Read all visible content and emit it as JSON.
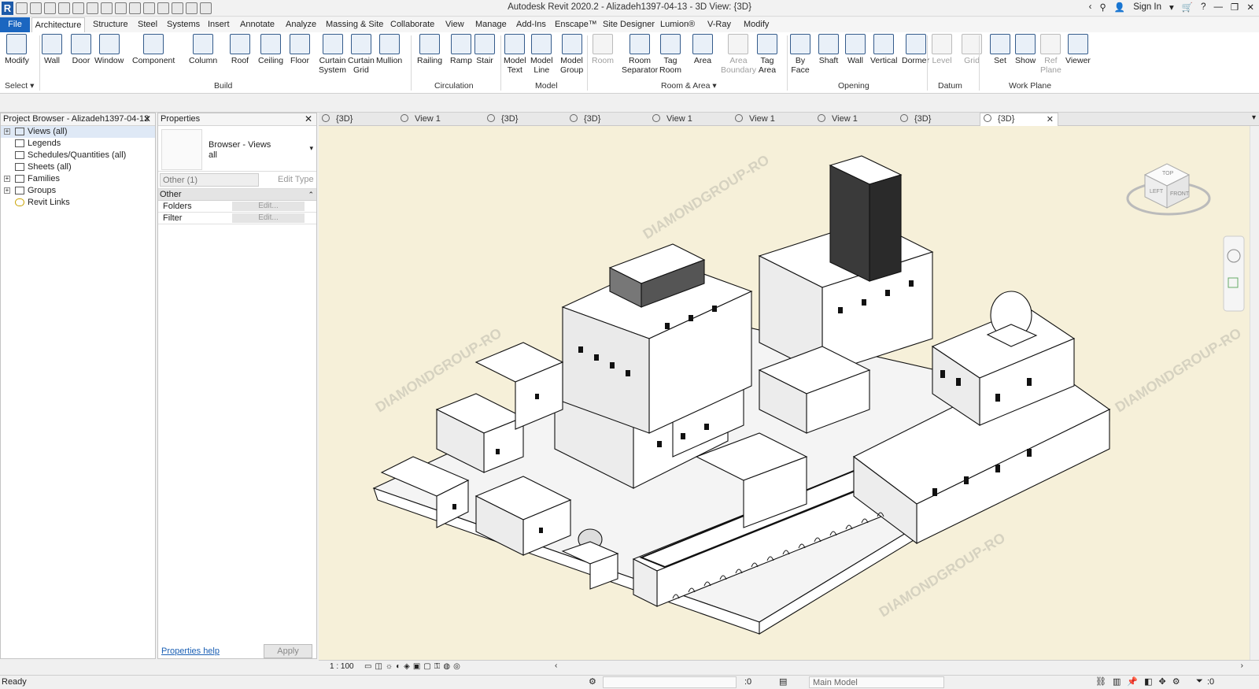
{
  "title_bar": {
    "title": "Autodesk Revit 2020.2 - Alizadeh1397-04-13 - 3D View: {3D}",
    "sign_in": "Sign In",
    "logo": "R"
  },
  "ribbon_tabs": [
    "File",
    "Architecture",
    "Structure",
    "Steel",
    "Systems",
    "Insert",
    "Annotate",
    "Analyze",
    "Massing & Site",
    "Collaborate",
    "View",
    "Manage",
    "Add-Ins",
    "Enscape™",
    "Site Designer",
    "Lumion®",
    "V-Ray",
    "Modify"
  ],
  "ribbon": {
    "tools": [
      {
        "l1": "Modify",
        "l2": ""
      },
      {
        "l1": "Wall",
        "l2": ""
      },
      {
        "l1": "Door",
        "l2": ""
      },
      {
        "l1": "Window",
        "l2": ""
      },
      {
        "l1": "Component",
        "l2": ""
      },
      {
        "l1": "Column",
        "l2": ""
      },
      {
        "l1": "Roof",
        "l2": ""
      },
      {
        "l1": "Ceiling",
        "l2": ""
      },
      {
        "l1": "Floor",
        "l2": ""
      },
      {
        "l1": "Curtain",
        "l2": "System"
      },
      {
        "l1": "Curtain",
        "l2": "Grid"
      },
      {
        "l1": "Mullion",
        "l2": ""
      },
      {
        "l1": "Railing",
        "l2": ""
      },
      {
        "l1": "Ramp",
        "l2": ""
      },
      {
        "l1": "Stair",
        "l2": ""
      },
      {
        "l1": "Model",
        "l2": "Text"
      },
      {
        "l1": "Model",
        "l2": "Line"
      },
      {
        "l1": "Model",
        "l2": "Group"
      },
      {
        "l1": "Room",
        "l2": ""
      },
      {
        "l1": "Room",
        "l2": "Separator"
      },
      {
        "l1": "Tag",
        "l2": "Room"
      },
      {
        "l1": "Area",
        "l2": ""
      },
      {
        "l1": "Area",
        "l2": "Boundary"
      },
      {
        "l1": "Tag",
        "l2": "Area"
      },
      {
        "l1": "By",
        "l2": "Face"
      },
      {
        "l1": "Shaft",
        "l2": ""
      },
      {
        "l1": "Wall",
        "l2": ""
      },
      {
        "l1": "Vertical",
        "l2": ""
      },
      {
        "l1": "Dormer",
        "l2": ""
      },
      {
        "l1": "Level",
        "l2": ""
      },
      {
        "l1": "Grid",
        "l2": ""
      },
      {
        "l1": "Set",
        "l2": ""
      },
      {
        "l1": "Show",
        "l2": ""
      },
      {
        "l1": "Ref",
        "l2": "Plane"
      },
      {
        "l1": "Viewer",
        "l2": ""
      }
    ],
    "groups": [
      "Select ▾",
      "Build",
      "Circulation",
      "Model",
      "Room & Area ▾",
      "Opening",
      "Datum",
      "Work Plane"
    ]
  },
  "project_browser": {
    "title": "Project Browser - Alizadeh1397-04-13",
    "items": [
      "Views (all)",
      "Legends",
      "Schedules/Quantities (all)",
      "Sheets (all)",
      "Families",
      "Groups",
      "Revit Links"
    ]
  },
  "properties": {
    "title": "Properties",
    "type_name": "Browser - Views",
    "type_sub": "all",
    "selector": "Other (1)",
    "edit_type": "Edit Type",
    "section": "Other",
    "rows": [
      {
        "name": "Folders",
        "value": "Edit..."
      },
      {
        "name": "Filter",
        "value": "Edit..."
      }
    ],
    "help": "Properties help",
    "apply": "Apply"
  },
  "view_tabs": [
    "{3D}",
    "View 1",
    "{3D}",
    "{3D}",
    "View 1",
    "View 1",
    "View 1",
    "{3D}",
    "{3D}"
  ],
  "viewport": {
    "scale": "1 : 100",
    "viewcube_top": "TOP",
    "viewcube_left": "LEFT",
    "viewcube_front": "FRONT"
  },
  "status_bar": {
    "ready": "Ready",
    "sel_count": ":0",
    "model": "Main Model",
    "filter_count": ":0"
  },
  "watermark": "DIAMONDGROUP-RO",
  "colors": {
    "file_tab": "#1b66c0",
    "viewport_bg": "#f6f0d9",
    "link": "#1a5fb4"
  }
}
